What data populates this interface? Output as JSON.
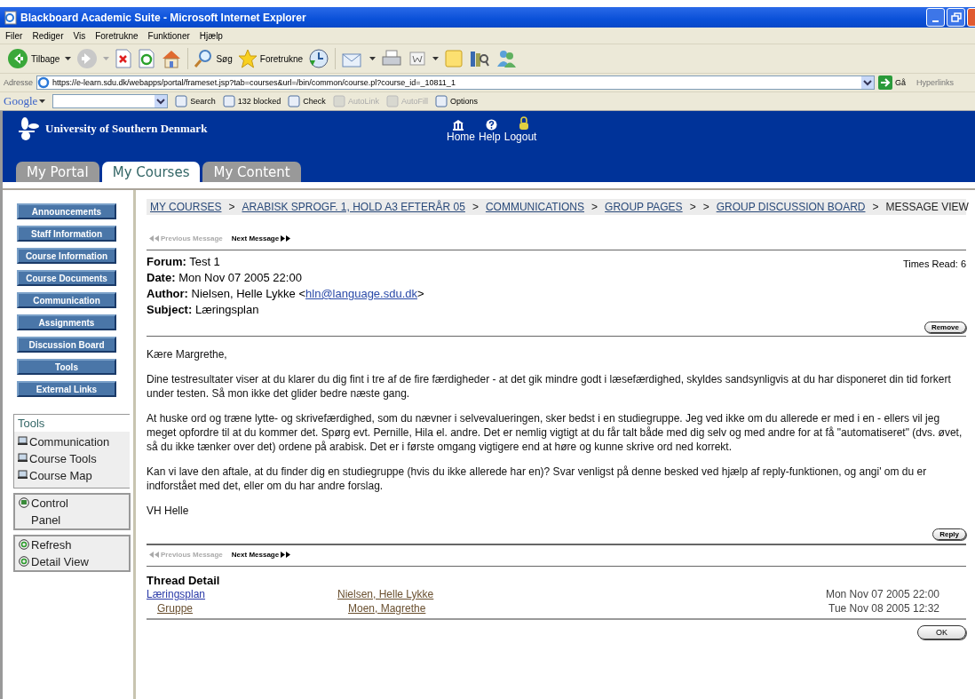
{
  "window": {
    "title": "Blackboard Academic Suite - Microsoft Internet Explorer"
  },
  "menu": [
    "Filer",
    "Rediger",
    "Vis",
    "Foretrukne",
    "Funktioner",
    "Hjælp"
  ],
  "toolbar": {
    "back": "Tilbage",
    "search": "Søg",
    "favorites": "Foretrukne"
  },
  "address": {
    "label": "Adresse",
    "url": "https://e-learn.sdu.dk/webapps/portal/frameset.jsp?tab=courses&url=/bin/common/course.pl?course_id=_10811_1",
    "go": "Gå",
    "links": "Hyperlinks"
  },
  "google_bar": {
    "logo": "Google",
    "items": [
      {
        "label": "Search",
        "disabled": false
      },
      {
        "label": "132 blocked",
        "disabled": false
      },
      {
        "label": "Check",
        "disabled": false
      },
      {
        "label": "AutoLink",
        "disabled": true
      },
      {
        "label": "AutoFill",
        "disabled": true
      },
      {
        "label": "Options",
        "disabled": false
      }
    ]
  },
  "site": {
    "name": "University of Southern Denmark",
    "nav": [
      "Home",
      "Help",
      "Logout"
    ]
  },
  "tabs": [
    {
      "label": "My Portal",
      "selected": false
    },
    {
      "label": "My Courses",
      "selected": true
    },
    {
      "label": "My Content",
      "selected": false
    }
  ],
  "sidebar": {
    "buttons": [
      "Announcements",
      "Staff Information",
      "Course Information",
      "Course Documents",
      "Communication",
      "Assignments",
      "Discussion Board",
      "Tools",
      "External Links"
    ],
    "tools_title": "Tools",
    "tools": [
      "Communication",
      "Course Tools",
      "Course Map"
    ],
    "control_panel": "Control Panel",
    "actions": [
      "Refresh",
      "Detail View"
    ]
  },
  "breadcrumb": [
    {
      "kind": "link",
      "text": "MY COURSES"
    },
    {
      "kind": "separator",
      "text": ">"
    },
    {
      "kind": "link",
      "text": "ARABISK SPROGF. 1, HOLD A3 EFTERÅR 05"
    },
    {
      "kind": "separator",
      "text": ">"
    },
    {
      "kind": "link",
      "text": "COMMUNICATIONS"
    },
    {
      "kind": "separator",
      "text": ">"
    },
    {
      "kind": "link",
      "text": "GROUP PAGES"
    },
    {
      "kind": "separator",
      "text": ">"
    },
    {
      "kind": "separator",
      "text": ">"
    },
    {
      "kind": "link",
      "text": "GROUP DISCUSSION BOARD"
    },
    {
      "kind": "separator",
      "text": ">"
    },
    {
      "kind": "current",
      "text": "MESSAGE VIEW"
    }
  ],
  "message_nav_top": [
    {
      "label": "Previous Message",
      "disabled": true
    },
    {
      "label": "Next Message",
      "disabled": false
    }
  ],
  "message": {
    "fields": [
      {
        "label": "Forum:",
        "value": "Test 1"
      },
      {
        "label": "Date:",
        "value": "Mon Nov 07 2005 22:00"
      },
      {
        "label": "Author:",
        "value": "Nielsen, Helle Lykke <",
        "email": "hln@language.sdu.dk",
        "after": ">"
      },
      {
        "label": "Subject:",
        "value": "Læringsplan"
      }
    ],
    "times_read": "Times Read: 6",
    "remove": "Remove",
    "body": [
      "Kære Margrethe,",
      "Dine testresultater viser at du klarer du dig fint i tre af de fire færdigheder - at det gik mindre godt i læsefærdighed, skyldes sandsynligvis at du har disponeret din tid forkert under testen. Så mon ikke det glider bedre næste gang.",
      "At huske ord og træne lytte- og skrivefærdighed, som du nævner i selvevalueringen, sker bedst i en studiegruppe. Jeg ved ikke om du allerede er med i en - ellers vil jeg meget opfordre til at du kommer det. Spørg evt. Pernille, Hila el. andre. Det er nemlig vigtigt at du får talt både med dig selv og med andre for at få \"automatiseret\" (dvs. øvet, så du ikke tænker over det) ordene på arabisk. Det er i første omgang vigtigere end at høre og kunne skrive ord ned korrekt.",
      "Kan vi lave den aftale, at du finder dig en studiegruppe (hvis du ikke allerede har en)? Svar venligst på denne besked ved hjælp af reply-funktionen, og angi' om du er indforstået med det, eller om du har andre forslag.",
      "VH Helle"
    ],
    "reply": "Reply"
  },
  "message_nav_bottom": [
    {
      "label": "Previous Message",
      "disabled": true
    },
    {
      "label": "Next Message",
      "disabled": false
    }
  ],
  "thread": {
    "title": "Thread Detail",
    "rows": [
      {
        "subject": "Læringsplan",
        "author": "Nielsen, Helle Lykke",
        "date": "Mon Nov 07 2005 22:00",
        "selected": true,
        "children": [
          {
            "subject": "Gruppe",
            "author": "Moen, Magrethe",
            "date": "Tue Nov 08 2005 12:32",
            "selected": false
          }
        ]
      }
    ]
  },
  "ok": "OK"
}
